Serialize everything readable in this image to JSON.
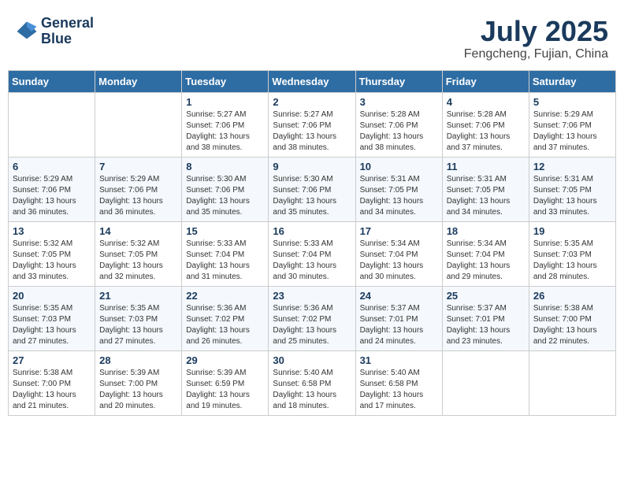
{
  "header": {
    "logo_line1": "General",
    "logo_line2": "Blue",
    "month": "July 2025",
    "location": "Fengcheng, Fujian, China"
  },
  "weekdays": [
    "Sunday",
    "Monday",
    "Tuesday",
    "Wednesday",
    "Thursday",
    "Friday",
    "Saturday"
  ],
  "weeks": [
    [
      {
        "day": "",
        "sunrise": "",
        "sunset": "",
        "daylight": ""
      },
      {
        "day": "",
        "sunrise": "",
        "sunset": "",
        "daylight": ""
      },
      {
        "day": "1",
        "sunrise": "Sunrise: 5:27 AM",
        "sunset": "Sunset: 7:06 PM",
        "daylight": "Daylight: 13 hours and 38 minutes."
      },
      {
        "day": "2",
        "sunrise": "Sunrise: 5:27 AM",
        "sunset": "Sunset: 7:06 PM",
        "daylight": "Daylight: 13 hours and 38 minutes."
      },
      {
        "day": "3",
        "sunrise": "Sunrise: 5:28 AM",
        "sunset": "Sunset: 7:06 PM",
        "daylight": "Daylight: 13 hours and 38 minutes."
      },
      {
        "day": "4",
        "sunrise": "Sunrise: 5:28 AM",
        "sunset": "Sunset: 7:06 PM",
        "daylight": "Daylight: 13 hours and 37 minutes."
      },
      {
        "day": "5",
        "sunrise": "Sunrise: 5:29 AM",
        "sunset": "Sunset: 7:06 PM",
        "daylight": "Daylight: 13 hours and 37 minutes."
      }
    ],
    [
      {
        "day": "6",
        "sunrise": "Sunrise: 5:29 AM",
        "sunset": "Sunset: 7:06 PM",
        "daylight": "Daylight: 13 hours and 36 minutes."
      },
      {
        "day": "7",
        "sunrise": "Sunrise: 5:29 AM",
        "sunset": "Sunset: 7:06 PM",
        "daylight": "Daylight: 13 hours and 36 minutes."
      },
      {
        "day": "8",
        "sunrise": "Sunrise: 5:30 AM",
        "sunset": "Sunset: 7:06 PM",
        "daylight": "Daylight: 13 hours and 35 minutes."
      },
      {
        "day": "9",
        "sunrise": "Sunrise: 5:30 AM",
        "sunset": "Sunset: 7:06 PM",
        "daylight": "Daylight: 13 hours and 35 minutes."
      },
      {
        "day": "10",
        "sunrise": "Sunrise: 5:31 AM",
        "sunset": "Sunset: 7:05 PM",
        "daylight": "Daylight: 13 hours and 34 minutes."
      },
      {
        "day": "11",
        "sunrise": "Sunrise: 5:31 AM",
        "sunset": "Sunset: 7:05 PM",
        "daylight": "Daylight: 13 hours and 34 minutes."
      },
      {
        "day": "12",
        "sunrise": "Sunrise: 5:31 AM",
        "sunset": "Sunset: 7:05 PM",
        "daylight": "Daylight: 13 hours and 33 minutes."
      }
    ],
    [
      {
        "day": "13",
        "sunrise": "Sunrise: 5:32 AM",
        "sunset": "Sunset: 7:05 PM",
        "daylight": "Daylight: 13 hours and 33 minutes."
      },
      {
        "day": "14",
        "sunrise": "Sunrise: 5:32 AM",
        "sunset": "Sunset: 7:05 PM",
        "daylight": "Daylight: 13 hours and 32 minutes."
      },
      {
        "day": "15",
        "sunrise": "Sunrise: 5:33 AM",
        "sunset": "Sunset: 7:04 PM",
        "daylight": "Daylight: 13 hours and 31 minutes."
      },
      {
        "day": "16",
        "sunrise": "Sunrise: 5:33 AM",
        "sunset": "Sunset: 7:04 PM",
        "daylight": "Daylight: 13 hours and 30 minutes."
      },
      {
        "day": "17",
        "sunrise": "Sunrise: 5:34 AM",
        "sunset": "Sunset: 7:04 PM",
        "daylight": "Daylight: 13 hours and 30 minutes."
      },
      {
        "day": "18",
        "sunrise": "Sunrise: 5:34 AM",
        "sunset": "Sunset: 7:04 PM",
        "daylight": "Daylight: 13 hours and 29 minutes."
      },
      {
        "day": "19",
        "sunrise": "Sunrise: 5:35 AM",
        "sunset": "Sunset: 7:03 PM",
        "daylight": "Daylight: 13 hours and 28 minutes."
      }
    ],
    [
      {
        "day": "20",
        "sunrise": "Sunrise: 5:35 AM",
        "sunset": "Sunset: 7:03 PM",
        "daylight": "Daylight: 13 hours and 27 minutes."
      },
      {
        "day": "21",
        "sunrise": "Sunrise: 5:35 AM",
        "sunset": "Sunset: 7:03 PM",
        "daylight": "Daylight: 13 hours and 27 minutes."
      },
      {
        "day": "22",
        "sunrise": "Sunrise: 5:36 AM",
        "sunset": "Sunset: 7:02 PM",
        "daylight": "Daylight: 13 hours and 26 minutes."
      },
      {
        "day": "23",
        "sunrise": "Sunrise: 5:36 AM",
        "sunset": "Sunset: 7:02 PM",
        "daylight": "Daylight: 13 hours and 25 minutes."
      },
      {
        "day": "24",
        "sunrise": "Sunrise: 5:37 AM",
        "sunset": "Sunset: 7:01 PM",
        "daylight": "Daylight: 13 hours and 24 minutes."
      },
      {
        "day": "25",
        "sunrise": "Sunrise: 5:37 AM",
        "sunset": "Sunset: 7:01 PM",
        "daylight": "Daylight: 13 hours and 23 minutes."
      },
      {
        "day": "26",
        "sunrise": "Sunrise: 5:38 AM",
        "sunset": "Sunset: 7:00 PM",
        "daylight": "Daylight: 13 hours and 22 minutes."
      }
    ],
    [
      {
        "day": "27",
        "sunrise": "Sunrise: 5:38 AM",
        "sunset": "Sunset: 7:00 PM",
        "daylight": "Daylight: 13 hours and 21 minutes."
      },
      {
        "day": "28",
        "sunrise": "Sunrise: 5:39 AM",
        "sunset": "Sunset: 7:00 PM",
        "daylight": "Daylight: 13 hours and 20 minutes."
      },
      {
        "day": "29",
        "sunrise": "Sunrise: 5:39 AM",
        "sunset": "Sunset: 6:59 PM",
        "daylight": "Daylight: 13 hours and 19 minutes."
      },
      {
        "day": "30",
        "sunrise": "Sunrise: 5:40 AM",
        "sunset": "Sunset: 6:58 PM",
        "daylight": "Daylight: 13 hours and 18 minutes."
      },
      {
        "day": "31",
        "sunrise": "Sunrise: 5:40 AM",
        "sunset": "Sunset: 6:58 PM",
        "daylight": "Daylight: 13 hours and 17 minutes."
      },
      {
        "day": "",
        "sunrise": "",
        "sunset": "",
        "daylight": ""
      },
      {
        "day": "",
        "sunrise": "",
        "sunset": "",
        "daylight": ""
      }
    ]
  ]
}
